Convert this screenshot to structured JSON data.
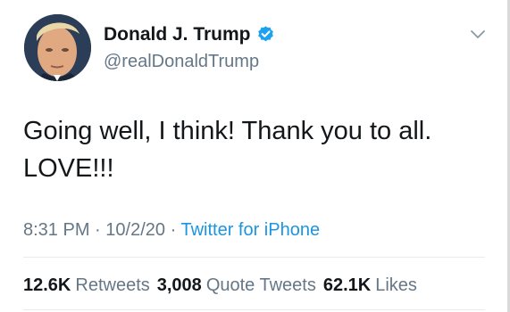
{
  "author": {
    "display_name": "Donald J. Trump",
    "handle": "@realDonaldTrump",
    "verified": true
  },
  "tweet": {
    "text": "Going well, I think! Thank you to all.\nLOVE!!!"
  },
  "meta": {
    "time": "8:31 PM",
    "separator": "·",
    "date": "10/2/20",
    "source": "Twitter for iPhone"
  },
  "stats": {
    "retweets_count": "12.6K",
    "retweets_label": "Retweets",
    "quotes_count": "3,008",
    "quotes_label": "Quote Tweets",
    "likes_count": "62.1K",
    "likes_label": "Likes"
  },
  "colors": {
    "verified_blue": "#1da1f2",
    "link_blue": "#1b95e0",
    "muted_gray": "#657786",
    "text_dark": "#14171a"
  }
}
